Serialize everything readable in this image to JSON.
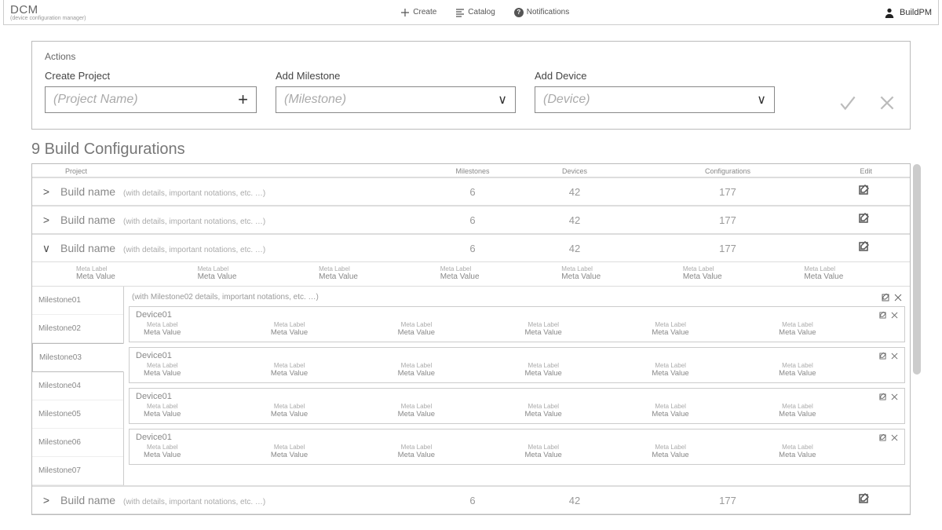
{
  "brand": {
    "main": "DCM",
    "sub": "(device configuration manager)"
  },
  "topnav": {
    "create": "Create",
    "catalog": "Catalog",
    "notifications": "Notifications"
  },
  "user": {
    "name": "BuildPM"
  },
  "actions": {
    "panel_title": "Actions",
    "create_project": {
      "label": "Create Project",
      "placeholder": "(Project Name)"
    },
    "add_milestone": {
      "label": "Add Milestone",
      "placeholder": "(Milestone)"
    },
    "add_device": {
      "label": "Add Device",
      "placeholder": "(Device)"
    }
  },
  "section": {
    "title": "9 Build Configurations"
  },
  "grid": {
    "headers": {
      "project": "Project",
      "milestones": "Milestones",
      "devices": "Devices",
      "configurations": "Configurations",
      "edit": "Edit"
    },
    "rows": [
      {
        "expanded": false,
        "name": "Build name",
        "details": "(with details, important notations, etc. …)",
        "milestones": "6",
        "devices": "42",
        "configurations": "177"
      },
      {
        "expanded": false,
        "name": "Build name",
        "details": "(with details, important notations, etc. …)",
        "milestones": "6",
        "devices": "42",
        "configurations": "177"
      },
      {
        "expanded": true,
        "name": "Build name",
        "details": "(with details, important notations, etc. …)",
        "milestones": "6",
        "devices": "42",
        "configurations": "177"
      },
      {
        "expanded": false,
        "name": "Build name",
        "details": "(with details, important notations, etc. …)",
        "milestones": "6",
        "devices": "42",
        "configurations": "177"
      }
    ]
  },
  "build_meta": {
    "label": "Meta Label",
    "value": "Meta Value"
  },
  "milestones_panel": {
    "header_detail": "(with Milestone02 details, important notations, etc. …)",
    "items": [
      "Milestone01",
      "Milestone02",
      "Milestone03",
      "Milestone04",
      "Milestone05",
      "Milestone06",
      "Milestone07"
    ],
    "selected_index": 2
  },
  "device": {
    "name": "Device01",
    "meta_label": "Meta Label",
    "meta_value": "Meta Value"
  }
}
